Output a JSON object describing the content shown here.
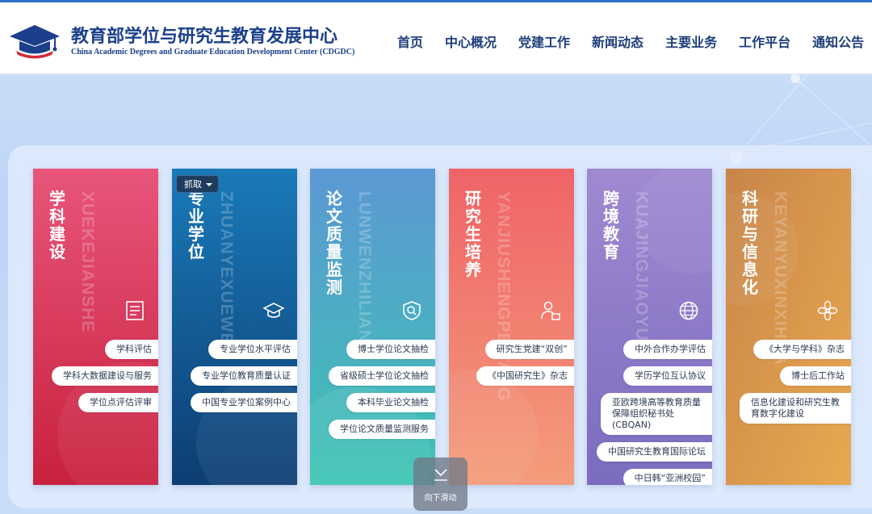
{
  "header": {
    "title_cn": "教育部学位与研究生教育发展中心",
    "title_en": "China Academic Degrees and Graduate Education Development Center (CDGDC)",
    "nav": [
      "首页",
      "中心概况",
      "党建工作",
      "新闻动态",
      "主要业务",
      "工作平台",
      "通知公告"
    ]
  },
  "colors": {
    "brand": "#1b3f8b",
    "nav_text": "#1d3d7a"
  },
  "cards": [
    {
      "title": "学科建设",
      "pinyin": "XUEKEJIANSHE",
      "icon": "document-icon",
      "links": [
        "学科评估",
        "学科大数据建设与服务",
        "学位点评估评审"
      ],
      "colors": [
        "#e85a7a",
        "#c81f3e"
      ]
    },
    {
      "title": "专业学位",
      "pinyin": "ZHUANYEXUEWEI",
      "icon": "graduation-cap-icon",
      "links": [
        "专业学位水平评估",
        "专业学位教育质量认证",
        "中国专业学位案例中心"
      ],
      "colors": [
        "#1a7ab8",
        "#0d3d73"
      ]
    },
    {
      "title": "论文质量监测",
      "pinyin": "LUNWENZHILIANG",
      "icon": "shield-search-icon",
      "links": [
        "博士学位论文抽检",
        "省级硕士学位论文抽检",
        "本科毕业论文抽检",
        "学位论文质量监测服务"
      ],
      "colors": [
        "#5d9ad4",
        "#3fc0b4"
      ]
    },
    {
      "title": "研究生培养",
      "pinyin": "YANJIUSHENGPEIYANG",
      "icon": "person-book-icon",
      "links": [
        "研究生党建“双创”",
        "《中国研究生》杂志"
      ],
      "colors": [
        "#f06b6b",
        "#f39a7a"
      ]
    },
    {
      "title": "跨境教育",
      "pinyin": "KUAJINGJIAOYU",
      "icon": "globe-icon",
      "links": [
        "中外合作办学评估",
        "学历学位互认协议",
        "亚欧跨境高等教育质量保障组织秘书处(CBQAN)",
        "中国研究生教育国际论坛",
        "中日韩“亚洲校园”"
      ],
      "colors": [
        "#9f86cf",
        "#7d6ec0"
      ]
    },
    {
      "title": "科研与信息化",
      "pinyin": "KEYANYUXINXIHUA",
      "icon": "flower-icon",
      "links": [
        "《大学与学科》杂志",
        "博士后工作站",
        "信息化建设和研究生教育数字化建设"
      ],
      "colors": [
        "#c8894a",
        "#e8a44e"
      ]
    }
  ],
  "grab_button": {
    "label": "抓取"
  },
  "scroll_hint": {
    "label": "向下滑动"
  }
}
